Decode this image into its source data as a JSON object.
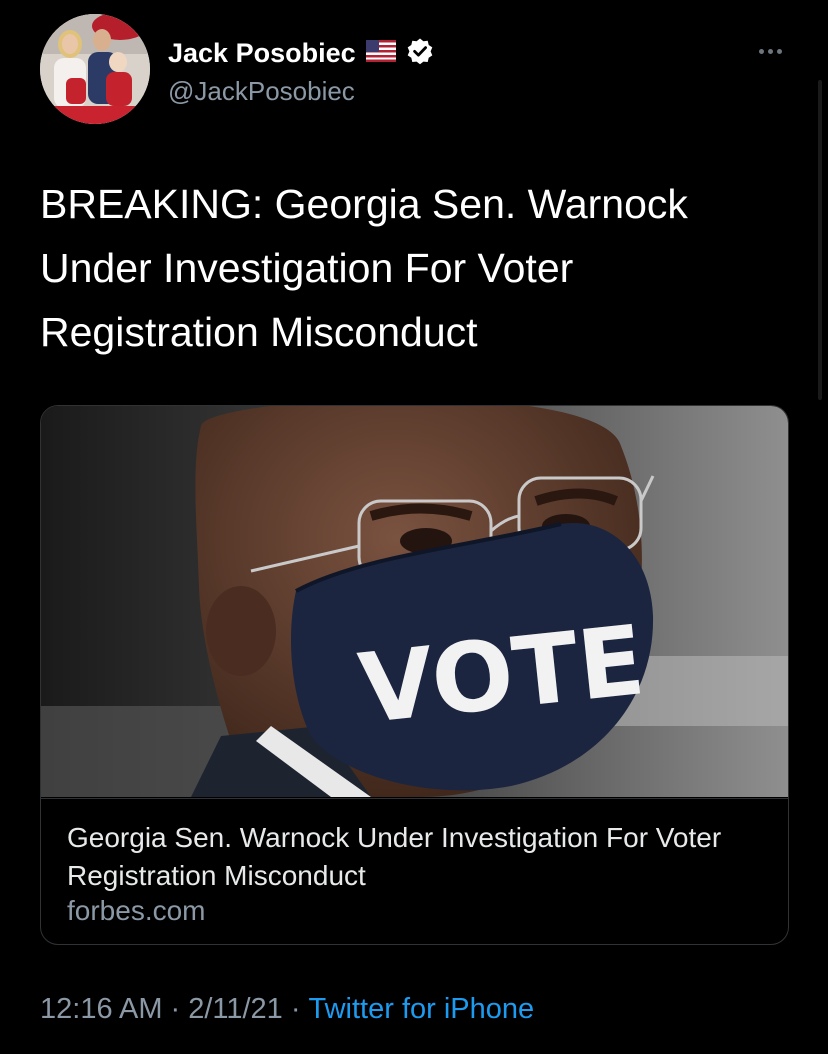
{
  "author": {
    "display_name": "Jack Posobiec",
    "handle": "@JackPosobiec",
    "flag_icon": "us-flag-icon",
    "verified_icon": "verified-badge-icon"
  },
  "tweet": {
    "text": "BREAKING: Georgia Sen. Warnock Under Investigation For Voter Registration Misconduct"
  },
  "card": {
    "image_text": "VOTE",
    "title": "Georgia Sen. Warnock Under Investigation For Voter Registration Misconduct",
    "domain": "forbes.com"
  },
  "meta": {
    "time": "12:16 AM",
    "date": "2/11/21",
    "separator": "·",
    "source": "Twitter for iPhone"
  },
  "colors": {
    "background": "#000000",
    "text": "#e7e9ea",
    "secondary_text": "#8b98a5",
    "link": "#1d9bf0",
    "verified_badge": "#ffffff"
  }
}
